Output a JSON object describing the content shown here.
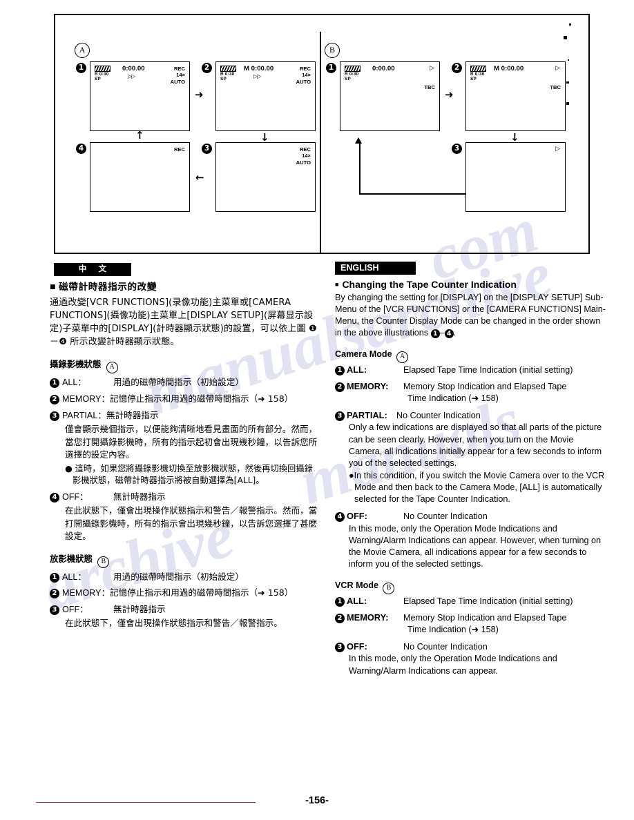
{
  "illustration": {
    "section_a_label": "A",
    "section_b_label": "B",
    "screens_a": [
      {
        "num": "1",
        "tape_remaining": "R  0:30",
        "speed": "SP",
        "counter": "0:00.00",
        "play_glyph": "▷▷",
        "right_lines": [
          "REC",
          "14×",
          "AUTO"
        ]
      },
      {
        "num": "2",
        "tape_remaining": "R  0:30",
        "speed": "SP",
        "counter": "M 0:00.00",
        "play_glyph": "▷▷",
        "right_lines": [
          "REC",
          "14×",
          "AUTO"
        ]
      },
      {
        "num": "3",
        "tape_remaining": "",
        "speed": "",
        "counter": "",
        "play_glyph": "",
        "right_lines": [
          "REC",
          "14×",
          "AUTO"
        ]
      },
      {
        "num": "4",
        "tape_remaining": "",
        "speed": "",
        "counter": "",
        "play_glyph": "",
        "right_lines": [
          "REC"
        ]
      }
    ],
    "screens_b": [
      {
        "num": "1",
        "tape_remaining": "R  0:30",
        "speed": "SP",
        "counter": "0:00.00",
        "play_glyph": "▷",
        "tbc": "TBC"
      },
      {
        "num": "2",
        "tape_remaining": "R  0:30",
        "speed": "SP",
        "counter": "M 0:00.00",
        "play_glyph": "▷",
        "tbc": "TBC"
      },
      {
        "num": "3",
        "tape_remaining": "",
        "speed": "",
        "counter": "",
        "play_glyph": "▷",
        "tbc": ""
      }
    ],
    "arrows": {
      "right": "➜",
      "down": "↓",
      "up": "↑",
      "left": "←"
    }
  },
  "chinese": {
    "banner": "中 文",
    "heading": "磁帶計時器指示的改變",
    "intro": "通過改變[VCR FUNCTIONS](录像功能)主菜單或[CAMERA FUNCTIONS](攝像功能)主菜單上[DISPLAY SETUP](屏幕显示設定)子菜單中的[DISPLAY](計時器顯示狀態)的設置，可以依上圖 ❶－❹ 所示改變計時器顯示狀態。",
    "camera_mode_heading": "攝錄影機狀態",
    "camera_mode_tag": "A",
    "camera_items": [
      {
        "num": "1",
        "key": "ALL：",
        "text": "用過的磁帶時間指示（初始設定）",
        "body": "",
        "bullet": ""
      },
      {
        "num": "2",
        "key": "MEMORY：",
        "text": "記憶停止指示和用過的磁帶時間指示（➜ 158）",
        "body": "",
        "bullet": ""
      },
      {
        "num": "3",
        "key": "PARTIAL：",
        "text": "無計時器指示",
        "body": "僅會顯示幾個指示，以便能夠清晰地看見畫面的所有部分。然而，當您打開攝錄影機時，所有的指示起初會出現幾秒鐘，以告訴您所選擇的設定內容。",
        "bullet": "● 這時，如果您將攝錄影機切換至放影機狀態，然後再切換回攝錄影機狀態，磁帶計時器指示將被自動選擇為[ALL]。"
      },
      {
        "num": "4",
        "key": "OFF：",
        "text": "無計時器指示",
        "body": "在此狀態下，僅會出現操作狀態指示和警告／報警指示。然而，當打開攝錄影機時，所有的指示會出現幾秒鐘，以告訴您選擇了甚麼設定。",
        "bullet": ""
      }
    ],
    "vcr_mode_heading": "放影機狀態",
    "vcr_mode_tag": "B",
    "vcr_items": [
      {
        "num": "1",
        "key": "ALL：",
        "text": "用過的磁帶時間指示（初始設定）",
        "body": ""
      },
      {
        "num": "2",
        "key": "MEMORY：",
        "text": "記憶停止指示和用過的磁帶時間指示（➜ 158）",
        "body": ""
      },
      {
        "num": "3",
        "key": "OFF：",
        "text": "無計時器指示",
        "body": "在此狀態下，僅會出現操作狀態指示和警告／報警指示。"
      }
    ]
  },
  "english": {
    "banner": "ENGLISH",
    "heading": "Changing the Tape Counter Indication",
    "intro_before": "By changing the setting for [DISPLAY] on the [DISPLAY SETUP] Sub-Menu of the [VCR FUNCTIONS] or the [CAMERA FUNCTIONS] Main-Menu, the Counter Display Mode can be changed in the order shown in the above illustrations",
    "intro_num_first": "1",
    "intro_dash": "–",
    "intro_num_last": "4",
    "intro_after": ".",
    "camera_mode_heading": "Camera Mode",
    "camera_mode_tag": "A",
    "camera_items": [
      {
        "num": "1",
        "key": "ALL:",
        "text": "Elapsed Tape Time Indication (initial setting)",
        "cont": "",
        "body": "",
        "bullet": ""
      },
      {
        "num": "2",
        "key": "MEMORY:",
        "text": "Memory Stop Indication and Elapsed Tape",
        "cont": "Time Indication (➜ 158)",
        "body": "",
        "bullet": ""
      },
      {
        "num": "3",
        "key": "PARTIAL:",
        "text": "No Counter Indication",
        "cont": "",
        "body": "Only a few indications are displayed so that all parts of the picture can be seen clearly. However, when you turn on the Movie Camera, all indications initially appear for a few seconds to inform you of the selected settings.",
        "bullet": "●In this condition, if you switch the Movie Camera over to the VCR Mode and then back to the Camera Mode, [ALL] is automatically selected for the Tape Counter Indication."
      },
      {
        "num": "4",
        "key": "OFF:",
        "text": "No Counter Indication",
        "cont": "",
        "body": "In this mode, only the Operation Mode Indications and Warning/Alarm Indications can appear. However, when turning on the Movie Camera, all indications appear for a few seconds to inform you of the selected settings.",
        "bullet": ""
      }
    ],
    "vcr_mode_heading": "VCR Mode",
    "vcr_mode_tag": "B",
    "vcr_items": [
      {
        "num": "1",
        "key": "ALL:",
        "text": "Elapsed Tape Time Indication (initial setting)",
        "cont": "",
        "body": ""
      },
      {
        "num": "2",
        "key": "MEMORY:",
        "text": "Memory Stop Indication and Elapsed Tape",
        "cont": "Time Indication (➜ 158)",
        "body": ""
      },
      {
        "num": "3",
        "key": "OFF:",
        "text": "No Counter Indication",
        "cont": "",
        "body": "In this mode, only the Operation Mode Indications and Warning/Alarm Indications can appear."
      }
    ]
  },
  "footer": {
    "page_number": "-156-"
  },
  "watermark": {
    "w1": "manualsarchive",
    "w2": "manuals",
    "w3": "archive",
    "w4": "com"
  },
  "colors": {
    "ink": "#000000",
    "paper": "#ffffff",
    "rule_red": "#a8324a",
    "watermark": "#c9cbe8"
  }
}
